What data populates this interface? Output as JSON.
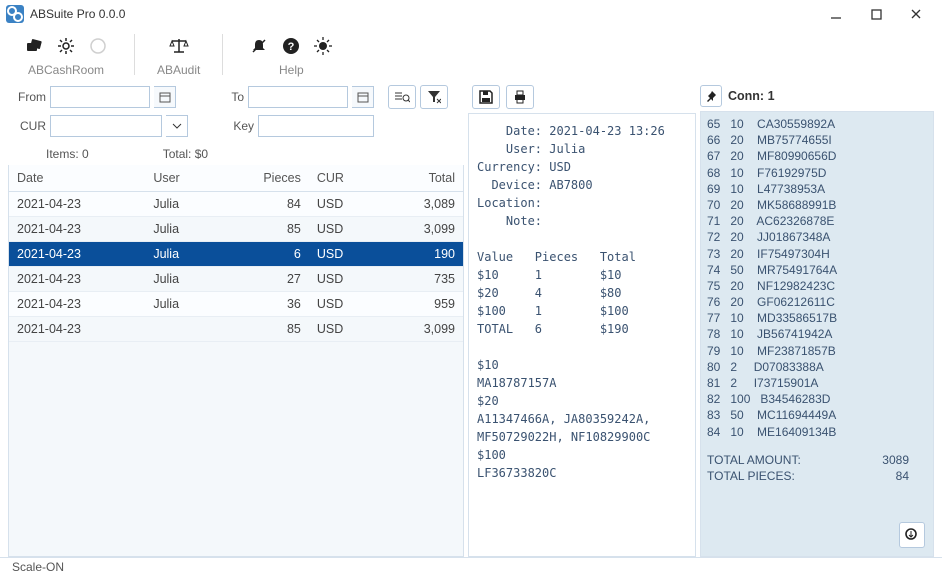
{
  "title": "ABSuite Pro 0.0.0",
  "toolbar": {
    "cashroom": "ABCashRoom",
    "audit": "ABAudit",
    "help": "Help"
  },
  "filters": {
    "from_label": "From",
    "to_label": "To",
    "cur_label": "CUR",
    "key_label": "Key",
    "from_val": "",
    "to_val": "",
    "cur_val": "",
    "key_val": ""
  },
  "summary": {
    "items_label": "Items: 0",
    "total_label": "Total: $0"
  },
  "grid": {
    "headers": {
      "date": "Date",
      "user": "User",
      "pieces": "Pieces",
      "cur": "CUR",
      "total": "Total"
    },
    "rows": [
      {
        "date": "2021-04-23",
        "user": "Julia",
        "pieces": "84",
        "cur": "USD",
        "total": "3,089",
        "sel": false
      },
      {
        "date": "2021-04-23",
        "user": "Julia",
        "pieces": "85",
        "cur": "USD",
        "total": "3,099",
        "sel": false
      },
      {
        "date": "2021-04-23",
        "user": "Julia",
        "pieces": "6",
        "cur": "USD",
        "total": "190",
        "sel": true
      },
      {
        "date": "2021-04-23",
        "user": "Julia",
        "pieces": "27",
        "cur": "USD",
        "total": "735",
        "sel": false
      },
      {
        "date": "2021-04-23",
        "user": "Julia",
        "pieces": "36",
        "cur": "USD",
        "total": "959",
        "sel": false
      },
      {
        "date": "2021-04-23",
        "user": "",
        "pieces": "85",
        "cur": "USD",
        "total": "3,099",
        "sel": false
      }
    ]
  },
  "detail": {
    "date_lbl": "Date:",
    "date": "2021-04-23 13:26",
    "user_lbl": "User:",
    "user": "Julia",
    "curr_lbl": "Currency:",
    "curr": "USD",
    "dev_lbl": "Device:",
    "dev": "AB7800",
    "loc_lbl": "Location:",
    "loc": "",
    "note_lbl": "Note:",
    "note": "",
    "hdr_value": "Value",
    "hdr_pieces": "Pieces",
    "hdr_total": "Total",
    "lines": [
      {
        "v": "$10",
        "p": "1",
        "t": "$10"
      },
      {
        "v": "$20",
        "p": "4",
        "t": "$80"
      },
      {
        "v": "$100",
        "p": "1",
        "t": "$100"
      },
      {
        "v": "TOTAL",
        "p": "6",
        "t": "$190"
      }
    ],
    "serials": [
      "$10",
      "MA18787157A",
      "$20",
      "A11347466A, JA80359242A,",
      "MF50729022H, NF10829900C",
      "$100",
      "LF36733820C"
    ]
  },
  "conn": {
    "pin_tip": "Pin",
    "label": "Conn: 1",
    "rows": [
      {
        "n": "65",
        "q": "10",
        "s": "CA30559892A"
      },
      {
        "n": "66",
        "q": "20",
        "s": "MB75774655I"
      },
      {
        "n": "67",
        "q": "20",
        "s": "MF80990656D"
      },
      {
        "n": "68",
        "q": "10",
        "s": "F76192975D"
      },
      {
        "n": "69",
        "q": "10",
        "s": "L47738953A"
      },
      {
        "n": "70",
        "q": "20",
        "s": "MK58688991B"
      },
      {
        "n": "71",
        "q": "20",
        "s": "AC62326878E"
      },
      {
        "n": "72",
        "q": "20",
        "s": "JJ01867348A"
      },
      {
        "n": "73",
        "q": "20",
        "s": "IF75497304H"
      },
      {
        "n": "74",
        "q": "50",
        "s": "MR75491764A"
      },
      {
        "n": "75",
        "q": "20",
        "s": "NF12982423C"
      },
      {
        "n": "76",
        "q": "20",
        "s": "GF06212611C"
      },
      {
        "n": "77",
        "q": "10",
        "s": "MD33586517B"
      },
      {
        "n": "78",
        "q": "10",
        "s": "JB56741942A"
      },
      {
        "n": "79",
        "q": "10",
        "s": "MF23871857B"
      },
      {
        "n": "80",
        "q": "2",
        "s": "D07083388A"
      },
      {
        "n": "81",
        "q": "2",
        "s": "I73715901A"
      },
      {
        "n": "82",
        "q": "100",
        "s": "B34546283D"
      },
      {
        "n": "83",
        "q": "50",
        "s": "MC11694449A"
      },
      {
        "n": "84",
        "q": "10",
        "s": "ME16409134B"
      }
    ],
    "tot_amount_lbl": "TOTAL AMOUNT:",
    "tot_amount": "3089",
    "tot_pieces_lbl": "TOTAL PIECES:",
    "tot_pieces": "84"
  },
  "status": "Scale-ON"
}
